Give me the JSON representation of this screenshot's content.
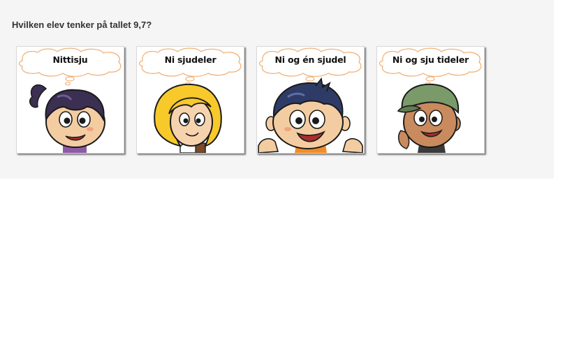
{
  "question": "Hvilken elev tenker på tallet 9,7?",
  "options": [
    {
      "label": "Nittisju",
      "character": "girl-dark-hair-ponytail"
    },
    {
      "label": "Ni sjudeler",
      "character": "girl-blonde-hair"
    },
    {
      "label": "Ni og én sjudel",
      "character": "boy-dark-hair-open-arms"
    },
    {
      "label": "Ni og sju tideler",
      "character": "boy-green-cap"
    }
  ]
}
